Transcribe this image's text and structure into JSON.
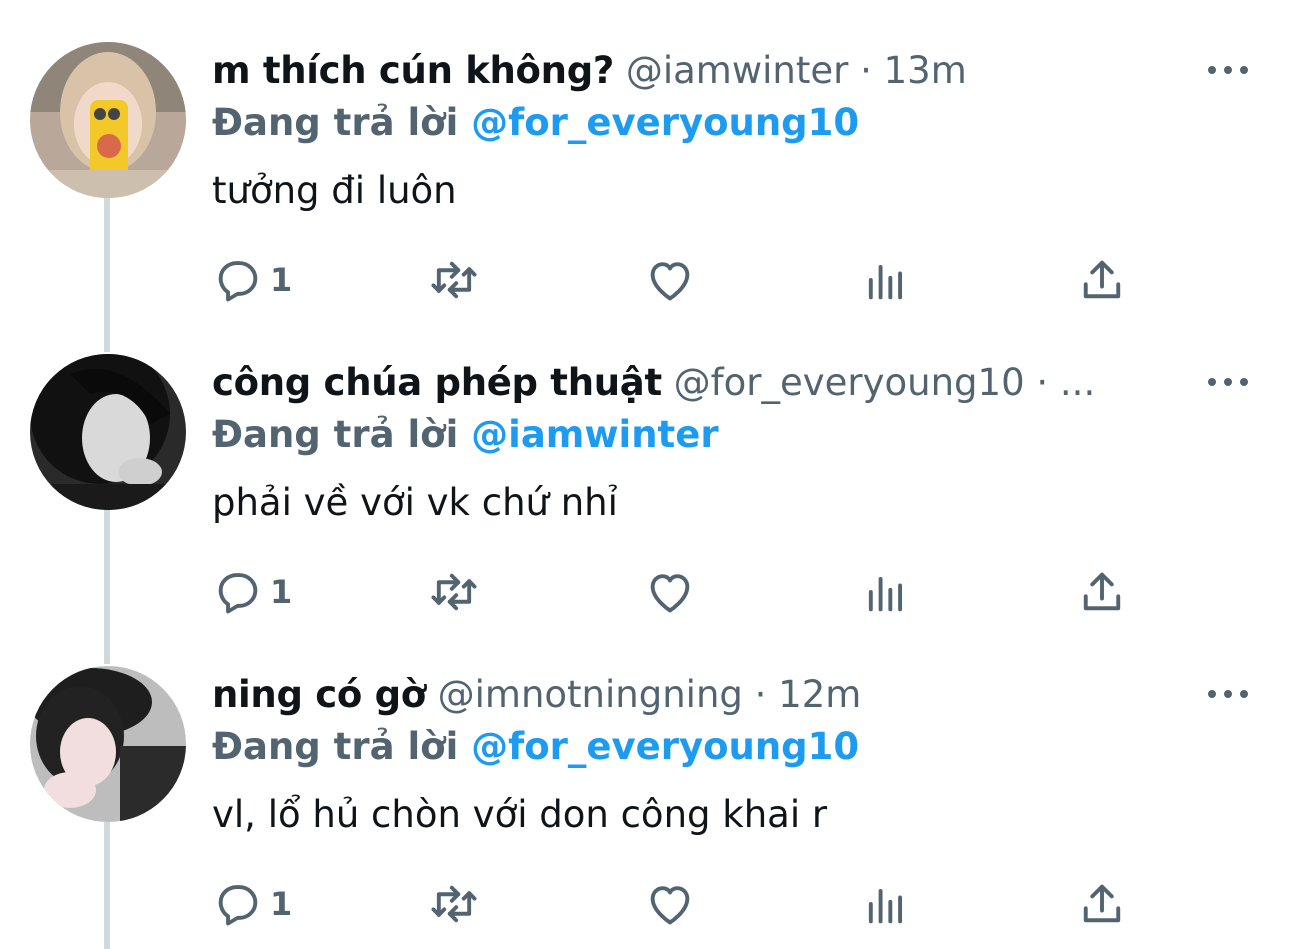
{
  "tweets": [
    {
      "display_name": "m thích cún không?",
      "handle": "@iamwinter",
      "separator": "·",
      "time": "13m",
      "reply_prefix": "Đang trả lời",
      "reply_to": "@for_everyoung10",
      "text": "tưởng đi luôn",
      "reply_count": "1"
    },
    {
      "display_name": "công chúa phép thuật",
      "handle": "@for_everyoung10",
      "separator": "·",
      "time": "...",
      "reply_prefix": "Đang trả lời",
      "reply_to": "@iamwinter",
      "text": "phải về với vk chứ nhỉ",
      "reply_count": "1"
    },
    {
      "display_name": "ning có gờ",
      "handle": "@imnotningning",
      "separator": "·",
      "time": "12m",
      "reply_prefix": "Đang trả lời",
      "reply_to": "@for_everyoung10",
      "text": "vl, lổ hủ chòn với don công khai r",
      "reply_count": "1"
    }
  ],
  "icons": {
    "more": "more-horizontal-icon",
    "reply": "reply-bubble-icon",
    "retweet": "retweet-icon",
    "like": "heart-icon",
    "views": "views-bar-chart-icon",
    "share": "share-upload-icon"
  },
  "colors": {
    "text_primary": "#0f1419",
    "text_secondary": "#536471",
    "mention_blue": "#1d9bf0",
    "thread_line": "#cfd9de"
  }
}
